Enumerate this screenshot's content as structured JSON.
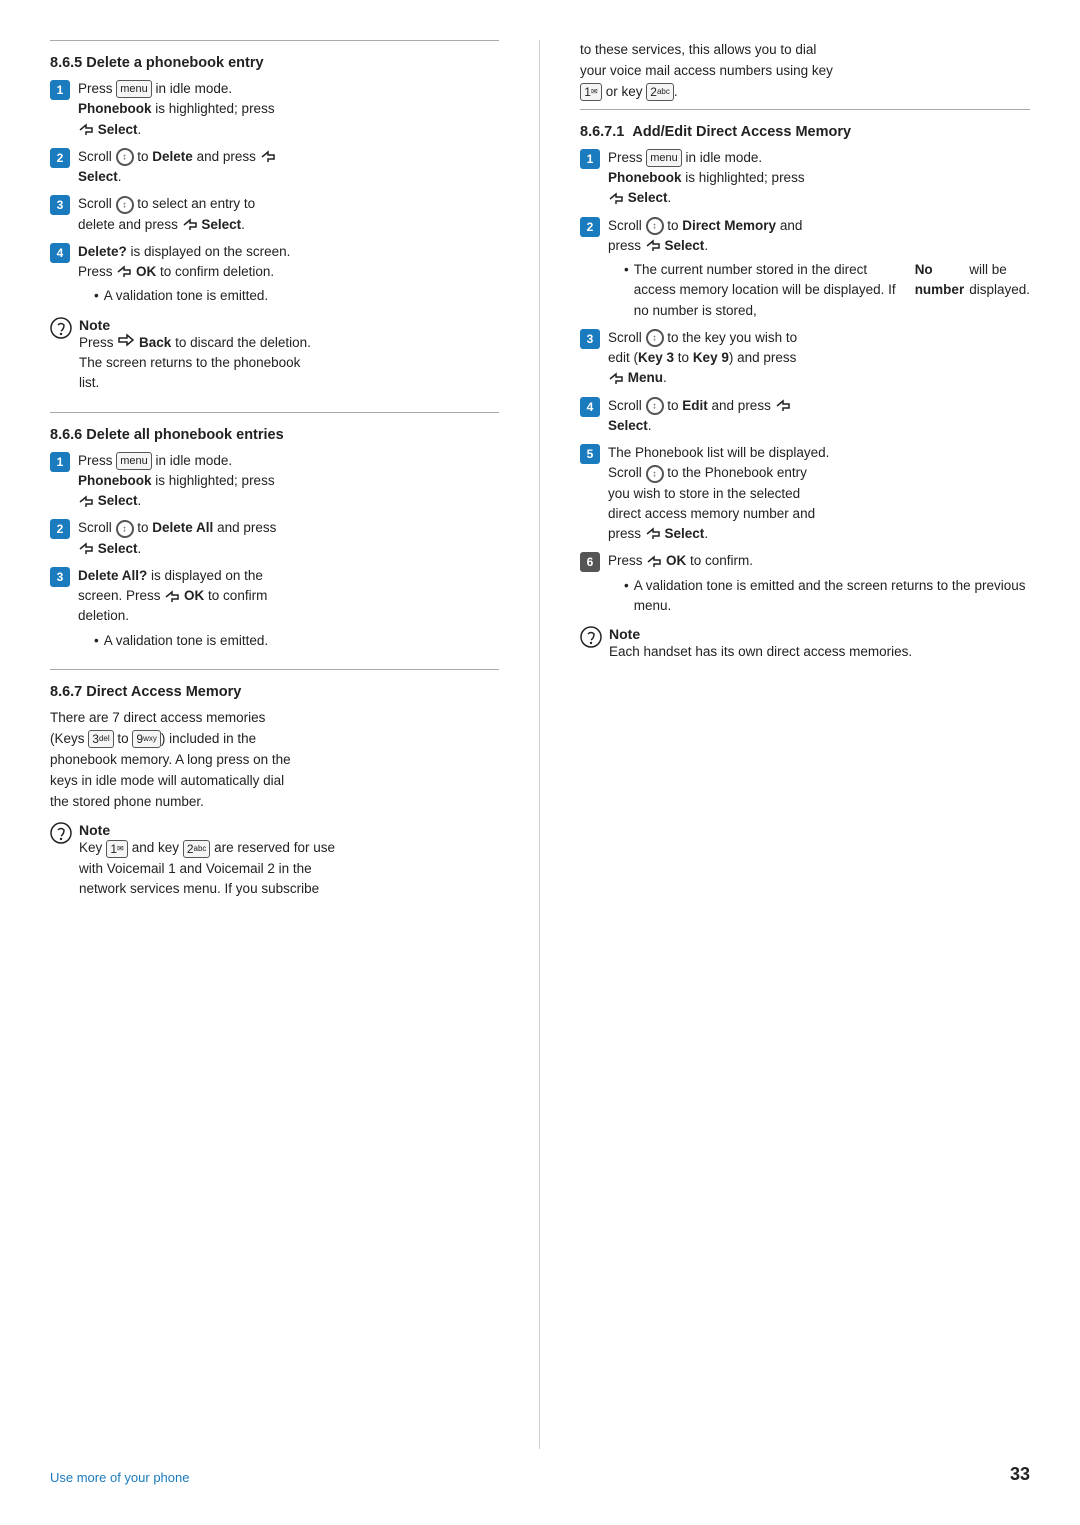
{
  "page": {
    "number": "33",
    "footer_link": "Use more of your phone"
  },
  "left": {
    "section_865": {
      "title": "8.6.5  Delete a phonebook entry",
      "steps": [
        {
          "num": "1",
          "text": "Press [menu] in idle mode. <b>Phonebook</b> is highlighted; press [select] <b>Select</b>."
        },
        {
          "num": "2",
          "text": "Scroll [nav] to <b>Delete</b> and press [select] <b>Select</b>."
        },
        {
          "num": "3",
          "text": "Scroll [nav] to select an entry to delete and press [select] <b>Select</b>."
        },
        {
          "num": "4",
          "text": "<b>Delete?</b> is displayed on the screen. Press [select] <b>OK</b> to confirm deletion.",
          "bullet": "A validation tone is emitted."
        }
      ],
      "note_label": "Note",
      "note_text": "Press [back] <b>Back</b> to discard the deletion. The screen returns to the phonebook list."
    },
    "section_866": {
      "title": "8.6.6  Delete all phonebook entries",
      "steps": [
        {
          "num": "1",
          "text": "Press [menu] in idle mode. <b>Phonebook</b> is highlighted; press [select] <b>Select</b>."
        },
        {
          "num": "2",
          "text": "Scroll [nav] to <b>Delete All</b> and press [select] <b>Select</b>."
        },
        {
          "num": "3",
          "text": "<b>Delete All?</b> is displayed on the screen. Press [select] <b>OK</b> to confirm deletion.",
          "bullet": "A validation tone is emitted."
        }
      ]
    },
    "section_867": {
      "title": "8.6.7  Direct Access Memory",
      "intro": "There are 7 direct access memories (Keys [3] to [9]) included in the phonebook memory. A long press on the keys in idle mode will automatically dial the stored phone number.",
      "note_label": "Note",
      "note_text": "Key [1] and key [2] are reserved for use with Voicemail 1 and Voicemail 2 in the network services menu. If you subscribe"
    }
  },
  "right": {
    "top_text": "to these services, this allows you to dial your voice mail access numbers using key [1] or key [2].",
    "section_8671": {
      "title_num": "8.6.7.1",
      "title_name": "Add/Edit Direct Access Memory",
      "steps": [
        {
          "num": "1",
          "text": "Press [menu] in idle mode. <b>Phonebook</b> is highlighted; press [select] <b>Select</b>."
        },
        {
          "num": "2",
          "text": "Scroll [nav] to <b>Direct Memory</b> and press [select] <b>Select</b>.",
          "bullet": "The current number stored in the direct access memory location will be displayed. If no number is stored, <b>No number</b> will be displayed."
        },
        {
          "num": "3",
          "text": "Scroll [nav] to the key you wish to edit (<b>Key 3</b> to <b>Key 9</b>) and press [select] <b>Menu</b>."
        },
        {
          "num": "4",
          "text": "Scroll [nav] to <b>Edit</b> and press [select] <b>Select</b>."
        },
        {
          "num": "5",
          "text": "The Phonebook list will be displayed. Scroll [nav] to the Phonebook entry you wish to store in the selected direct access memory number and press [select] <b>Select</b>."
        },
        {
          "num": "6",
          "text": "Press [select] <b>OK</b> to confirm.",
          "bullet": "A validation tone is emitted and the screen returns to the previous menu."
        }
      ],
      "note_label": "Note",
      "note_text": "Each handset has its own direct access memories."
    }
  }
}
